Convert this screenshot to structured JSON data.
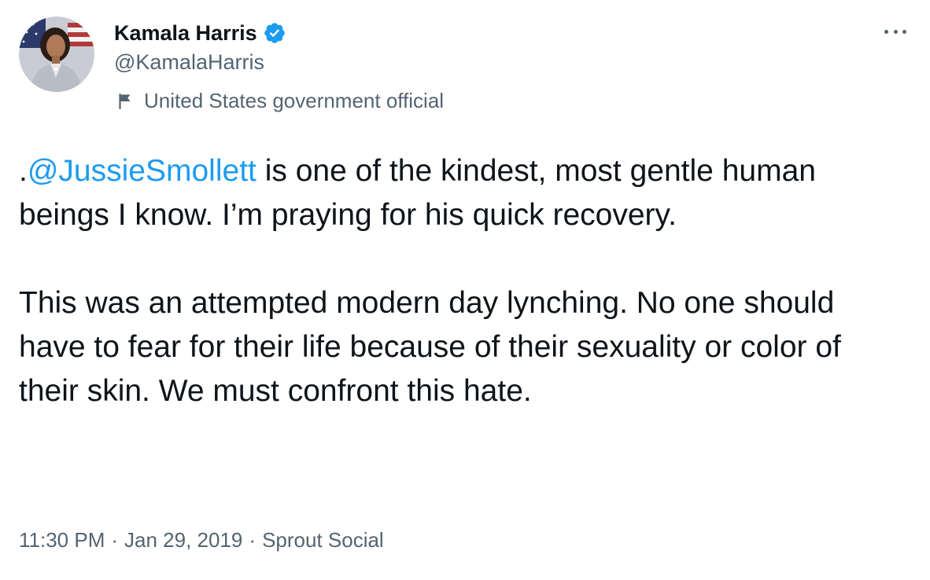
{
  "author": {
    "display_name": "Kamala Harris",
    "handle": "@KamalaHarris",
    "verified_icon": "verified-badge-icon",
    "label": "United States government official",
    "label_icon": "flag-icon"
  },
  "tweet": {
    "prefix": ".",
    "mention": "@JussieSmollett",
    "para1_rest": " is one of the kindest, most gentle human beings I know. I’m praying for his quick recovery.",
    "para2": "This was an attempted modern day lynching. No one should have to fear for their life because of their sexuality or color of their skin. We must confront this hate."
  },
  "meta": {
    "time": "11:30 PM",
    "date": "Jan 29, 2019",
    "source": "Sprout Social",
    "separator": "·"
  },
  "colors": {
    "accent": "#1d9bf0",
    "text": "#0f1419",
    "secondary": "#536471"
  }
}
